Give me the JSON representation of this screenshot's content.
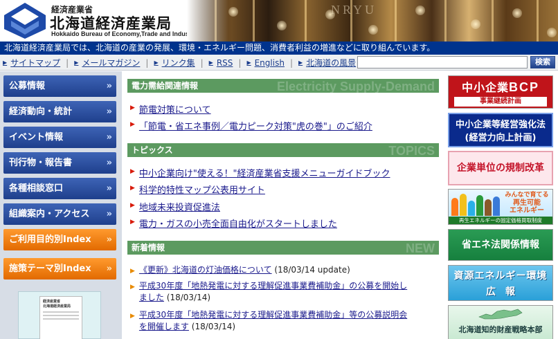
{
  "header": {
    "ministry": "経済産業省",
    "bureau": "北海道経済産業局",
    "bureau_en": "Hokkaido Bureau of Economy,Trade and Industry",
    "photo_text": "NRYU"
  },
  "tagline": "北海道経済産業局では、北海道の産業の発展、環境・エネルギー問題、消費者利益の増進などに取り組んでいます。",
  "utility_nav": {
    "items": [
      "サイトマップ",
      "メールマガジン",
      "リンク集",
      "RSS",
      "English",
      "北海道の風景"
    ],
    "separator": "|"
  },
  "search": {
    "value": "",
    "button_label": "検索"
  },
  "left_nav": {
    "items": [
      "公募情報",
      "経済動向・統計",
      "イベント情報",
      "刊行物・報告書",
      "各種相談窓口",
      "組織案内・アクセス",
      "ご利用目的別Index",
      "施策テーマ別Index"
    ],
    "chevron": "»"
  },
  "left_banner": {
    "line1": "経済産業省",
    "line2": "北海道経済産業局"
  },
  "sections": {
    "power": {
      "title": "電力需給関連情報",
      "watermark": "Electricity Supply-Demand",
      "links": [
        "節電対策について",
        "「節電・省エネ事例／電力ピーク対策\"虎の巻\"」のご紹介"
      ]
    },
    "topics": {
      "title": "トピックス",
      "watermark": "TOPICS",
      "links": [
        "中小企業向け\"使える！\"経済産業省支援メニューガイドブック",
        "科学的特性マップ公表用サイト",
        "地域未来投資促進法",
        "電力・ガスの小売全面自由化がスタートしました"
      ]
    },
    "news": {
      "title": "新着情報",
      "watermark": "NEW",
      "items": [
        {
          "line1": "《更新》北海道の灯油価格について",
          "line2": "",
          "date": "(18/03/14 update)"
        },
        {
          "line1": "平成30年度「地熱発電に対する理解促進事業費補助金」の公募を開始し",
          "line2": "ました",
          "date": "(18/03/14)"
        },
        {
          "line1": "平成30年度「地熱発電に対する理解促進事業費補助金」等の公募説明会",
          "line2": "を開催します",
          "date": "(18/03/14)"
        }
      ]
    }
  },
  "right_banners": {
    "bcp": {
      "line1a": "中小企業",
      "line1b": "BCP",
      "line2": "事業継続計画"
    },
    "kyoka": {
      "line1": "中小企業等経営強化法",
      "line2": "(経営力向上計画)"
    },
    "kisei": "企業単位の規制改革",
    "saiene": {
      "line1": "みんなで育てる",
      "line2": "再生可能",
      "line3": "エネルギー",
      "line4": "再生エネルギーの固定価格買取制度"
    },
    "shoene": "省エネ法関係情報",
    "shigen": {
      "line1": "資源エネルギー環境",
      "line2": "広報"
    },
    "chizai": "北海道知的財産戦略本部"
  },
  "colors": {
    "brand_blue": "#00338d",
    "nav_blue": "#1e3f8c",
    "nav_orange": "#e26a00",
    "section_green": "#5c9a60",
    "link_blue": "#1a1a8c",
    "marker_red": "#d81b0b",
    "marker_orange": "#e88a00"
  },
  "icons": {
    "logo": "bureau-logo-mark",
    "util_arrow": "triangle-right-icon",
    "nav_chevron": "double-chevron-right-icon",
    "link_marker": "triangle-right-icon"
  }
}
